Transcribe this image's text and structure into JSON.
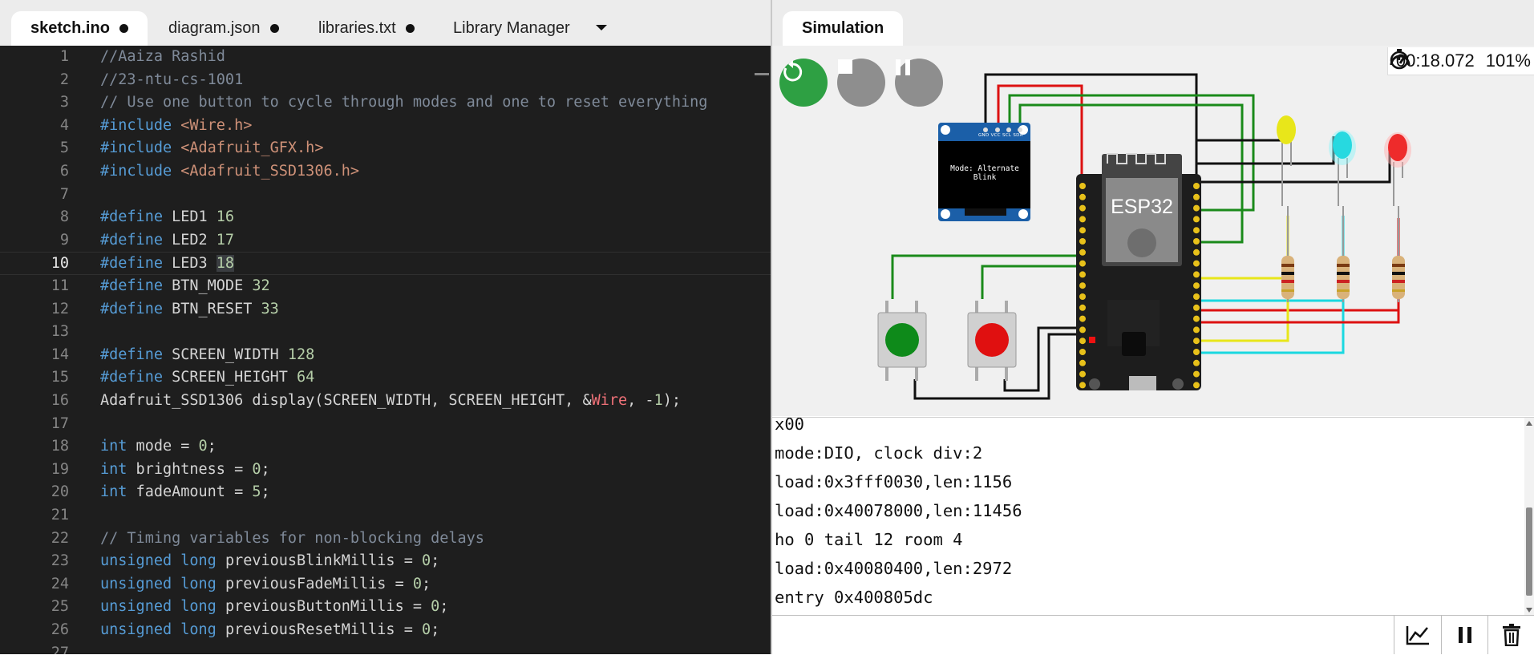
{
  "editor": {
    "tabs": [
      {
        "label": "sketch.ino",
        "modified": true
      },
      {
        "label": "diagram.json",
        "modified": true
      },
      {
        "label": "libraries.txt",
        "modified": true
      },
      {
        "label": "Library Manager",
        "modified": false
      }
    ],
    "current_line": 10,
    "lines": [
      {
        "n": "1",
        "html": "<span class=\"c\">//Aaiza Rashid</span>"
      },
      {
        "n": "2",
        "html": "<span class=\"c\">//23-ntu-cs-1001</span>"
      },
      {
        "n": "3",
        "html": "<span class=\"c\">// Use one button to cycle through modes and one to reset everything</span>"
      },
      {
        "n": "4",
        "html": "<span class=\"k\">#include</span> <span class=\"s\">&lt;Wire.h&gt;</span>"
      },
      {
        "n": "5",
        "html": "<span class=\"k\">#include</span> <span class=\"s\">&lt;Adafruit_GFX.h&gt;</span>"
      },
      {
        "n": "6",
        "html": "<span class=\"k\">#include</span> <span class=\"s\">&lt;Adafruit_SSD1306.h&gt;</span>"
      },
      {
        "n": "7",
        "html": ""
      },
      {
        "n": "8",
        "html": "<span class=\"k\">#define</span> LED1 <span class=\"n\">16</span>"
      },
      {
        "n": "9",
        "html": "<span class=\"k\">#define</span> LED2 <span class=\"n\">17</span>"
      },
      {
        "n": "10",
        "html": "<span class=\"k\">#define</span> LED3 <span class=\"n hl\">18</span>"
      },
      {
        "n": "11",
        "html": "<span class=\"k\">#define</span> BTN_MODE <span class=\"n\">32</span>"
      },
      {
        "n": "12",
        "html": "<span class=\"k\">#define</span> BTN_RESET <span class=\"n\">33</span>"
      },
      {
        "n": "13",
        "html": ""
      },
      {
        "n": "14",
        "html": "<span class=\"k\">#define</span> SCREEN_WIDTH <span class=\"n\">128</span>"
      },
      {
        "n": "15",
        "html": "<span class=\"k\">#define</span> SCREEN_HEIGHT <span class=\"n\">64</span>"
      },
      {
        "n": "16",
        "html": "Adafruit_SSD1306 display(SCREEN_WIDTH, SCREEN_HEIGHT, &amp;<span class=\"r\">Wire</span>, -<span class=\"n\">1</span>);"
      },
      {
        "n": "17",
        "html": ""
      },
      {
        "n": "18",
        "html": "<span class=\"k\">int</span> mode = <span class=\"n\">0</span>;"
      },
      {
        "n": "19",
        "html": "<span class=\"k\">int</span> brightness = <span class=\"n\">0</span>;"
      },
      {
        "n": "20",
        "html": "<span class=\"k\">int</span> fadeAmount = <span class=\"n\">5</span>;"
      },
      {
        "n": "21",
        "html": ""
      },
      {
        "n": "22",
        "html": "<span class=\"c\">// Timing variables for non-blocking delays</span>"
      },
      {
        "n": "23",
        "html": "<span class=\"k\">unsigned</span> <span class=\"k\">long</span> previousBlinkMillis = <span class=\"n\">0</span>;"
      },
      {
        "n": "24",
        "html": "<span class=\"k\">unsigned</span> <span class=\"k\">long</span> previousFadeMillis = <span class=\"n\">0</span>;"
      },
      {
        "n": "25",
        "html": "<span class=\"k\">unsigned</span> <span class=\"k\">long</span> previousButtonMillis = <span class=\"n\">0</span>;"
      },
      {
        "n": "26",
        "html": "<span class=\"k\">unsigned</span> <span class=\"k\">long</span> previousResetMillis = <span class=\"n\">0</span>;"
      },
      {
        "n": "27",
        "html": ""
      }
    ]
  },
  "simulation": {
    "tab_label": "Simulation",
    "timer": "00:18.072",
    "speed": "101%",
    "oled_text": "Mode: Alternate Blink",
    "oled_pins": [
      "GND",
      "VCC",
      "SCL",
      "SDA"
    ],
    "board_label": "ESP32",
    "leds": [
      {
        "color": "yellow",
        "hex": "#e8e61a"
      },
      {
        "color": "cyan",
        "hex": "#27d9e0"
      },
      {
        "color": "red",
        "hex": "#ee2b2b"
      }
    ],
    "buttons": [
      {
        "color": "green",
        "hex": "#0e8a1a"
      },
      {
        "color": "red",
        "hex": "#e01010"
      }
    ]
  },
  "serial": {
    "lines": [
      "x00",
      "mode:DIO, clock div:2",
      "load:0x3fff0030,len:1156",
      "load:0x40078000,len:11456",
      "ho 0 tail 12 room 4",
      "load:0x40080400,len:2972",
      "entry 0x400805dc"
    ],
    "input_value": ""
  }
}
